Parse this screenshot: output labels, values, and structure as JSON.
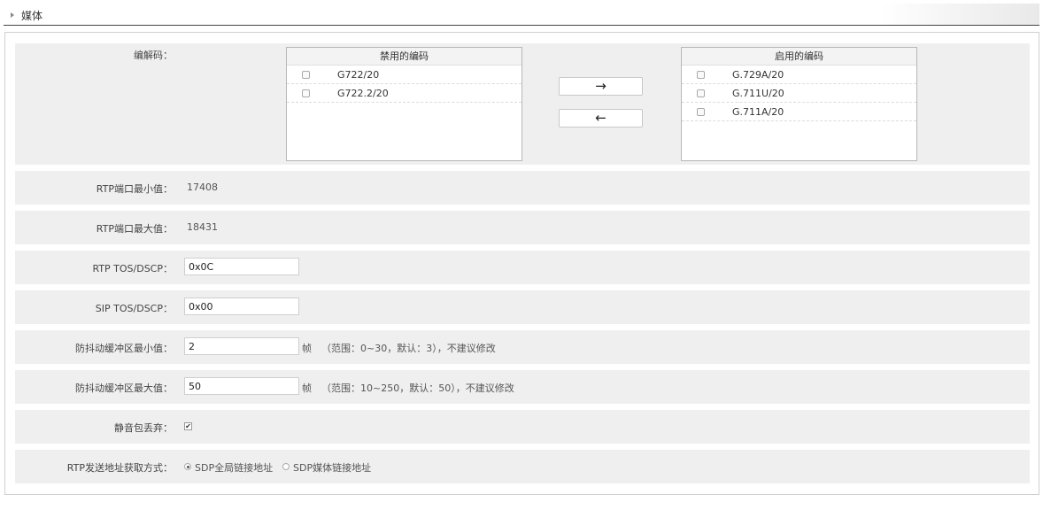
{
  "section": {
    "title": "媒体"
  },
  "codecs": {
    "label": "编解码：",
    "disabled_title": "禁用的编码",
    "disabled": [
      "G722/20",
      "G722.2/20"
    ],
    "enabled_title": "启用的编码",
    "enabled": [
      "G.729A/20",
      "G.711U/20",
      "G.711A/20"
    ],
    "move_right": "→",
    "move_left": "←"
  },
  "rtp_port_min": {
    "label": "RTP端口最小值：",
    "value": "17408"
  },
  "rtp_port_max": {
    "label": "RTP端口最大值：",
    "value": "18431"
  },
  "rtp_tos": {
    "label": "RTP TOS/DSCP：",
    "value": "0x0C"
  },
  "sip_tos": {
    "label": "SIP TOS/DSCP：",
    "value": "0x00"
  },
  "jitter_min": {
    "label": "防抖动缓冲区最小值：",
    "value": "2",
    "unit": "帧",
    "hint": "（范围：0~30，默认：3），不建议修改"
  },
  "jitter_max": {
    "label": "防抖动缓冲区最大值：",
    "value": "50",
    "unit": "帧",
    "hint": "（范围：10~250，默认：50），不建议修改"
  },
  "silence_drop": {
    "label": "静音包丢弃：",
    "checked": true,
    "mark": "✔"
  },
  "rtp_addr": {
    "label": "RTP发送地址获取方式：",
    "option1": "SDP全局链接地址",
    "option2": "SDP媒体链接地址",
    "selected": "option1"
  }
}
